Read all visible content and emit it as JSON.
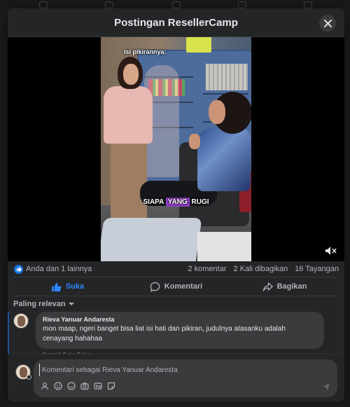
{
  "modal": {
    "title": "Postingan ResellerCamp"
  },
  "video": {
    "thought_caption": "Isi pikirannya:",
    "caption_before": "SIAPA ",
    "caption_highlight": "YANG",
    "caption_after": " RUGI"
  },
  "stats": {
    "reactions": "Anda dan 1 lainnya",
    "comments": "2 komentar",
    "shares": "2 Kali dibagikan",
    "views": "16 Tayangan"
  },
  "actions": {
    "like": "Suka",
    "comment": "Komentari",
    "share": "Bagikan"
  },
  "sort": {
    "label": "Paling relevan"
  },
  "comments": [
    {
      "author": "Rieva Yanuar Andaresta",
      "text": "mon maap, ngeri banget bisa liat isi hati dan pikiran, judulnya atasanku adalah cenayang hahahaa",
      "actions": "3 menit   Suka   Balas"
    }
  ],
  "composer": {
    "placeholder": "Komentari sebagai Rieva Yanuar Andaresta"
  },
  "colors": {
    "accent": "#2d88ff",
    "background": "#242526",
    "bubble": "#3a3b3c",
    "caption_highlight": "#8e3ec6"
  },
  "icons": [
    "close-icon",
    "like-icon",
    "comment-icon",
    "share-icon",
    "chevron-down-icon",
    "mute-icon",
    "avatar-icon",
    "emoji-icon",
    "camera-icon",
    "gif-icon",
    "sticker-icon",
    "send-icon"
  ]
}
